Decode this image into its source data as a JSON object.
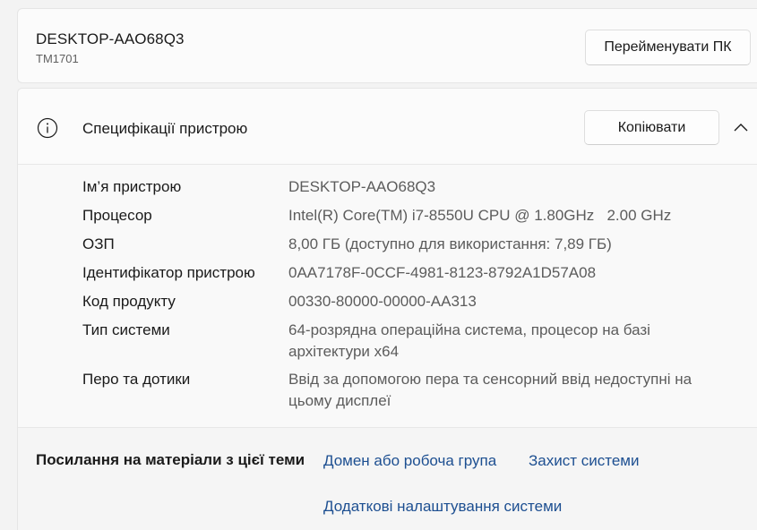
{
  "device": {
    "name": "DESKTOP-AAO68Q3",
    "model": "TM1701",
    "rename_label": "Перейменувати ПК"
  },
  "specs": {
    "title": "Специфікації пристрою",
    "copy_label": "Копіювати",
    "icons": {
      "info": "info-icon",
      "collapse": "chevron-up-icon"
    },
    "rows": [
      {
        "label": "Ім’я пристрою",
        "value": "DESKTOP-AAO68Q3"
      },
      {
        "label": "Процесор",
        "value": "Intel(R) Core(TM) i7-8550U CPU @ 1.80GHz   2.00 GHz"
      },
      {
        "label": "ОЗП",
        "value": "8,00 ГБ (доступно для використання: 7,89 ГБ)"
      },
      {
        "label": "Ідентифікатор пристрою",
        "value": "0AA7178F-0CCF-4981-8123-8792A1D57A08"
      },
      {
        "label": "Код продукту",
        "value": "00330-80000-00000-AA313"
      },
      {
        "label": "Тип системи",
        "value": "64-розрядна операційна система, процесор на базі архітектури x64"
      },
      {
        "label": "Перо та дотики",
        "value": "Ввід за допомогою пера та сенсорний ввід недоступні на цьому дисплеї"
      }
    ]
  },
  "related_links": {
    "title": "Посилання на матеріали з цієї теми",
    "links": [
      {
        "label": "Домен або робоча група"
      },
      {
        "label": "Захист системи"
      },
      {
        "label": "Додаткові налаштування системи"
      }
    ]
  },
  "colors": {
    "link": "#1d4f91",
    "background": "#f3f3f3",
    "card": "#fbfbfb"
  }
}
